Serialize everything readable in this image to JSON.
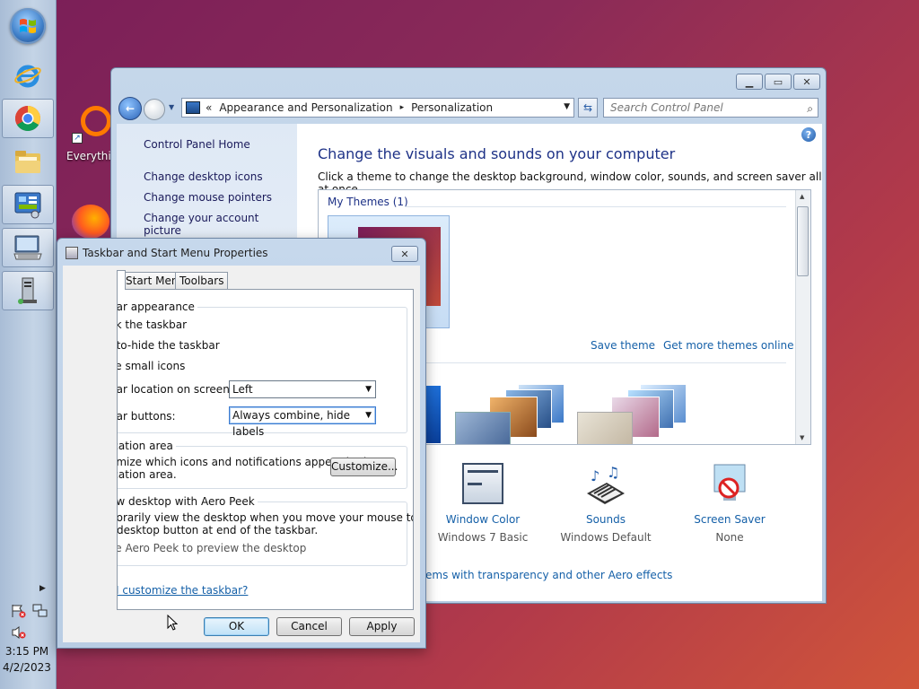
{
  "taskbar": {
    "clock_time": "3:15 PM",
    "clock_date": "4/2/2023",
    "buttons": [
      {
        "name": "internet-explorer-icon"
      },
      {
        "name": "chrome-icon"
      },
      {
        "name": "windows-explorer-icon"
      },
      {
        "name": "control-panel-icon"
      },
      {
        "name": "on-screen-keyboard-icon"
      },
      {
        "name": "server-icon"
      }
    ]
  },
  "desktop": {
    "icons": [
      {
        "label": "Everythin"
      }
    ]
  },
  "control_panel": {
    "breadcrumb": {
      "prefix": "«",
      "parent": "Appearance and Personalization",
      "sep": "▸",
      "current": "Personalization"
    },
    "search_placeholder": "Search Control Panel",
    "side_links": [
      "Control Panel Home",
      "Change desktop icons",
      "Change mouse pointers",
      "Change your account picture"
    ],
    "title": "Change the visuals and sounds on your computer",
    "subtitle": "Click a theme to change the desktop background, window color, sounds, and screen saver all at once.",
    "my_themes_header": "My Themes (1)",
    "save_theme": "Save theme",
    "get_more_themes": "Get more themes online",
    "bottom_items": [
      {
        "label": "Window Color",
        "value": "Windows 7 Basic"
      },
      {
        "label": "Sounds",
        "value": "Windows Default"
      },
      {
        "label": "Screen Saver",
        "value": "None"
      }
    ],
    "aero_link": "ems with transparency and other Aero effects"
  },
  "taskbar_dialog": {
    "title": "Taskbar and Start Menu Properties",
    "close_label": "✕",
    "tabs": [
      "Start Menu",
      "Toolbars"
    ],
    "appearance_group": "bar appearance",
    "lock_taskbar": "ck the taskbar",
    "auto_hide": "uto-hide the taskbar",
    "small_icons": "se small icons",
    "location_label": "bar location on screen:",
    "location_value": "Left",
    "buttons_label": "bar buttons:",
    "buttons_value": "Always combine, hide labels",
    "notification_group": "ication area",
    "notification_text_1": "omize which icons and notifications appear in the",
    "notification_text_2": "ication area.",
    "customize_button": "Customize...",
    "aero_group": "ew desktop with Aero Peek",
    "aero_text_1": "porarily view the desktop when you move your mouse to the",
    "aero_text_2": "desktop button at end of the taskbar.",
    "aero_checkbox": "se Aero Peek to preview the desktop",
    "help_link": "I customize the taskbar?",
    "ok": "OK",
    "cancel": "Cancel",
    "apply": "Apply"
  }
}
